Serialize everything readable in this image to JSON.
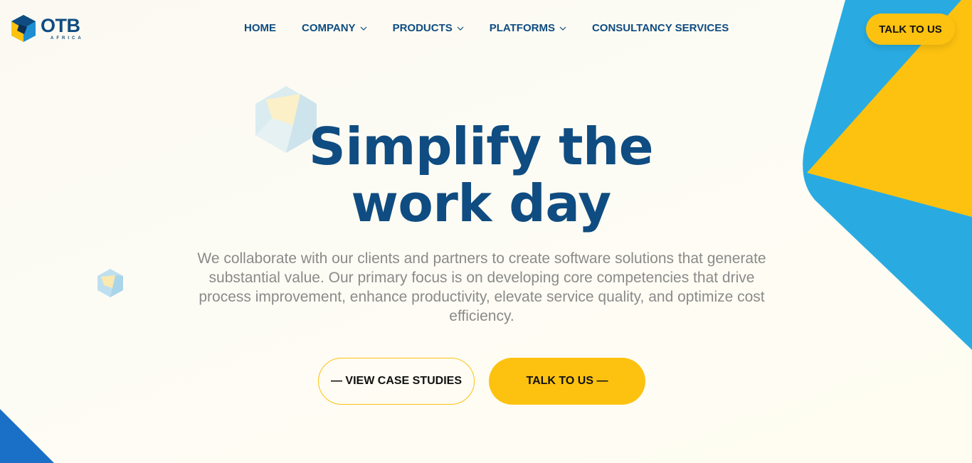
{
  "brand": {
    "name": "OTB",
    "tagline": "AFRICA",
    "colors": {
      "primary": "#0f4c81",
      "accent": "#fdc210",
      "sky": "#29abe2"
    }
  },
  "nav": {
    "items": [
      {
        "label": "HOME",
        "dropdown": false
      },
      {
        "label": "COMPANY",
        "dropdown": true
      },
      {
        "label": "PRODUCTS",
        "dropdown": true
      },
      {
        "label": "PLATFORMS",
        "dropdown": true
      },
      {
        "label": "CONSULTANCY SERVICES",
        "dropdown": false
      }
    ],
    "cta_label": "TALK TO US"
  },
  "hero": {
    "title_line1": "Simplify the",
    "title_line2": "work day",
    "description": "We collaborate with our clients and partners to create software solutions that generate substantial value. Our primary focus is on developing core competencies that drive process improvement, enhance productivity, elevate service quality, and optimize cost efficiency.",
    "secondary_button": "— VIEW CASE STUDIES",
    "primary_button": "TALK TO US —"
  },
  "icons": {
    "dropdown": "chevron-down-icon",
    "logo": "otb-hexagon-logo-icon",
    "decoration": "hexagon-cube-icon"
  }
}
